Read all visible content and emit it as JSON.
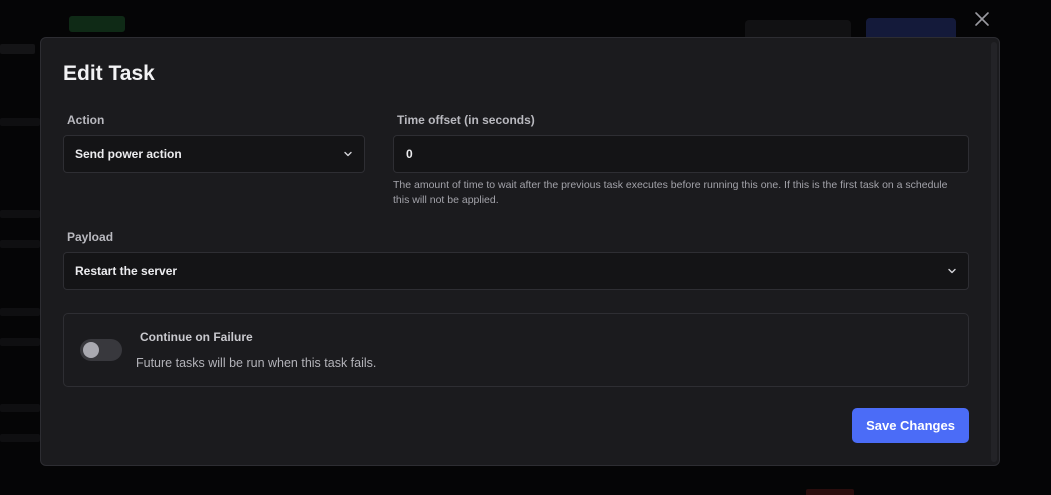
{
  "modal": {
    "title": "Edit Task",
    "close_icon": "close-icon",
    "action": {
      "label": "Action",
      "value": "Send power action",
      "icon": "chevron-down-icon"
    },
    "time_offset": {
      "label": "Time offset (in seconds)",
      "value": "0",
      "help": "The amount of time to wait after the previous task executes before running this one. If this is the first task on a schedule this will not be applied."
    },
    "payload": {
      "label": "Payload",
      "value": "Restart the server",
      "icon": "chevron-down-icon"
    },
    "continue_on_failure": {
      "title": "Continue on Failure",
      "description": "Future tasks will be run when this task fails.",
      "enabled": false
    },
    "save_label": "Save Changes"
  },
  "colors": {
    "accent": "#4b6cf7",
    "modal_bg": "#1b1b1e",
    "input_bg": "#141416",
    "backdrop": "#050506"
  }
}
